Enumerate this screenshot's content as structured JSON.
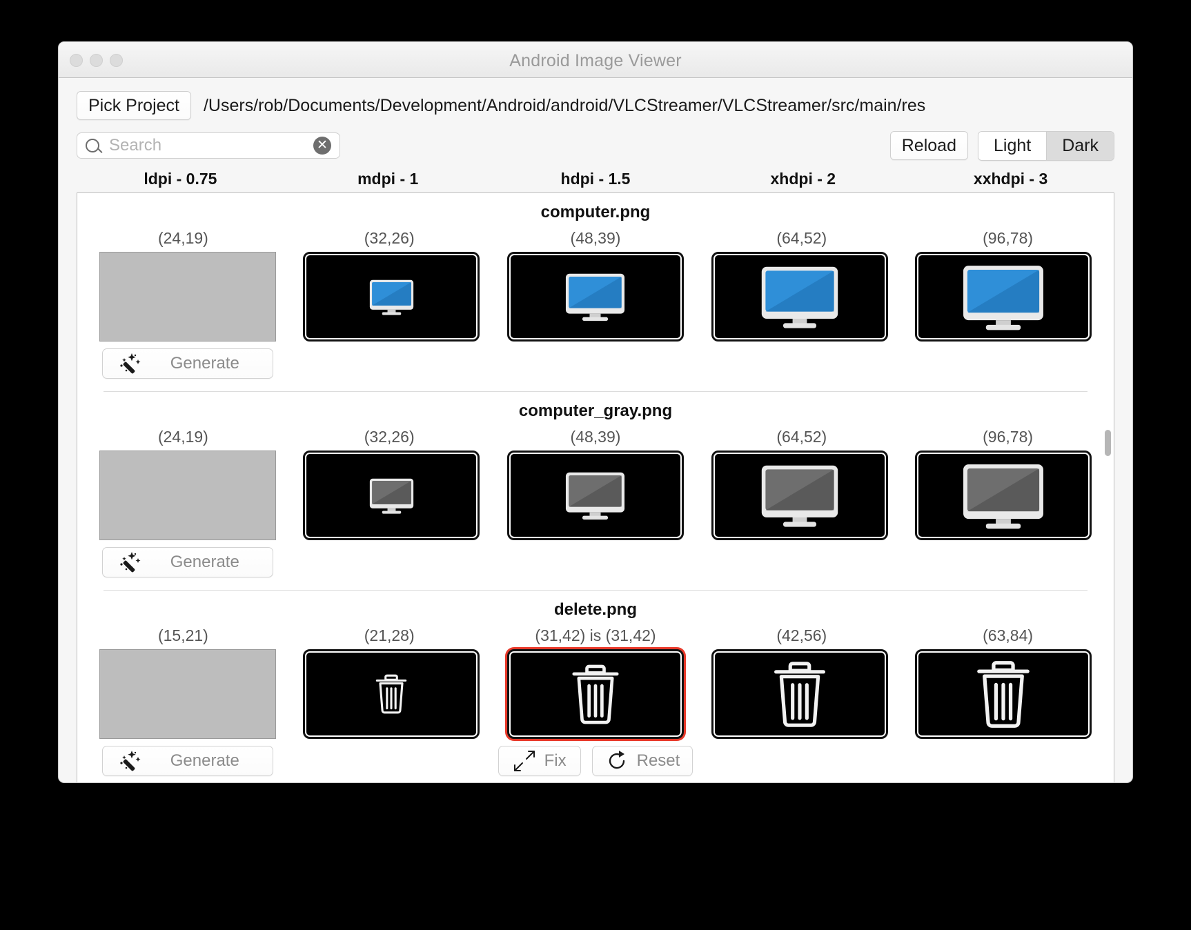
{
  "window": {
    "title": "Android Image Viewer"
  },
  "toolbar": {
    "pick_project_label": "Pick Project",
    "project_path": "/Users/rob/Documents/Development/Android/android/VLCStreamer/VLCStreamer/src/main/res",
    "search_placeholder": "Search",
    "search_value": "",
    "clear_icon": "circle-x-icon",
    "reload_label": "Reload",
    "theme_options": [
      "Light",
      "Dark"
    ],
    "theme_selected": "Dark"
  },
  "columns": [
    {
      "label": "ldpi - 0.75"
    },
    {
      "label": "mdpi - 1"
    },
    {
      "label": "hdpi - 1.5"
    },
    {
      "label": "xhdpi - 2"
    },
    {
      "label": "xxhdpi - 3"
    }
  ],
  "buttons": {
    "generate_label": "Generate",
    "generate_icon": "magic-wand-icon",
    "fix_label": "Fix",
    "fix_icon": "shrink-arrows-icon",
    "reset_label": "Reset",
    "reset_icon": "refresh-circle-icon"
  },
  "assets": [
    {
      "name": "computer.png",
      "cells": [
        {
          "dim": "(24,19)",
          "state": "missing",
          "icon": "none"
        },
        {
          "dim": "(32,26)",
          "state": "present",
          "icon": "monitor-blue-icon",
          "scale": 0.46
        },
        {
          "dim": "(48,39)",
          "state": "present",
          "icon": "monitor-blue-icon",
          "scale": 0.62
        },
        {
          "dim": "(64,52)",
          "state": "present",
          "icon": "monitor-blue-icon",
          "scale": 0.8
        },
        {
          "dim": "(96,78)",
          "state": "present",
          "icon": "monitor-blue-icon",
          "scale": 0.84
        }
      ],
      "action": "generate"
    },
    {
      "name": "computer_gray.png",
      "cells": [
        {
          "dim": "(24,19)",
          "state": "missing",
          "icon": "none"
        },
        {
          "dim": "(32,26)",
          "state": "present",
          "icon": "monitor-gray-icon",
          "scale": 0.46
        },
        {
          "dim": "(48,39)",
          "state": "present",
          "icon": "monitor-gray-icon",
          "scale": 0.62
        },
        {
          "dim": "(64,52)",
          "state": "present",
          "icon": "monitor-gray-icon",
          "scale": 0.8
        },
        {
          "dim": "(96,78)",
          "state": "present",
          "icon": "monitor-gray-icon",
          "scale": 0.84
        }
      ],
      "action": "generate"
    },
    {
      "name": "delete.png",
      "cells": [
        {
          "dim": "(15,21)",
          "state": "missing",
          "icon": "none"
        },
        {
          "dim": "(21,28)",
          "state": "present",
          "icon": "trash-outline-icon",
          "scale": 0.52
        },
        {
          "dim": "(31,42)  is (31,42)",
          "state": "flagged",
          "icon": "trash-outline-icon",
          "scale": 0.78
        },
        {
          "dim": "(42,56)",
          "state": "present",
          "icon": "trash-outline-icon",
          "scale": 0.86
        },
        {
          "dim": "(63,84)",
          "state": "present",
          "icon": "trash-outline-icon",
          "scale": 0.88
        }
      ],
      "action": "generate-fix-reset"
    }
  ]
}
